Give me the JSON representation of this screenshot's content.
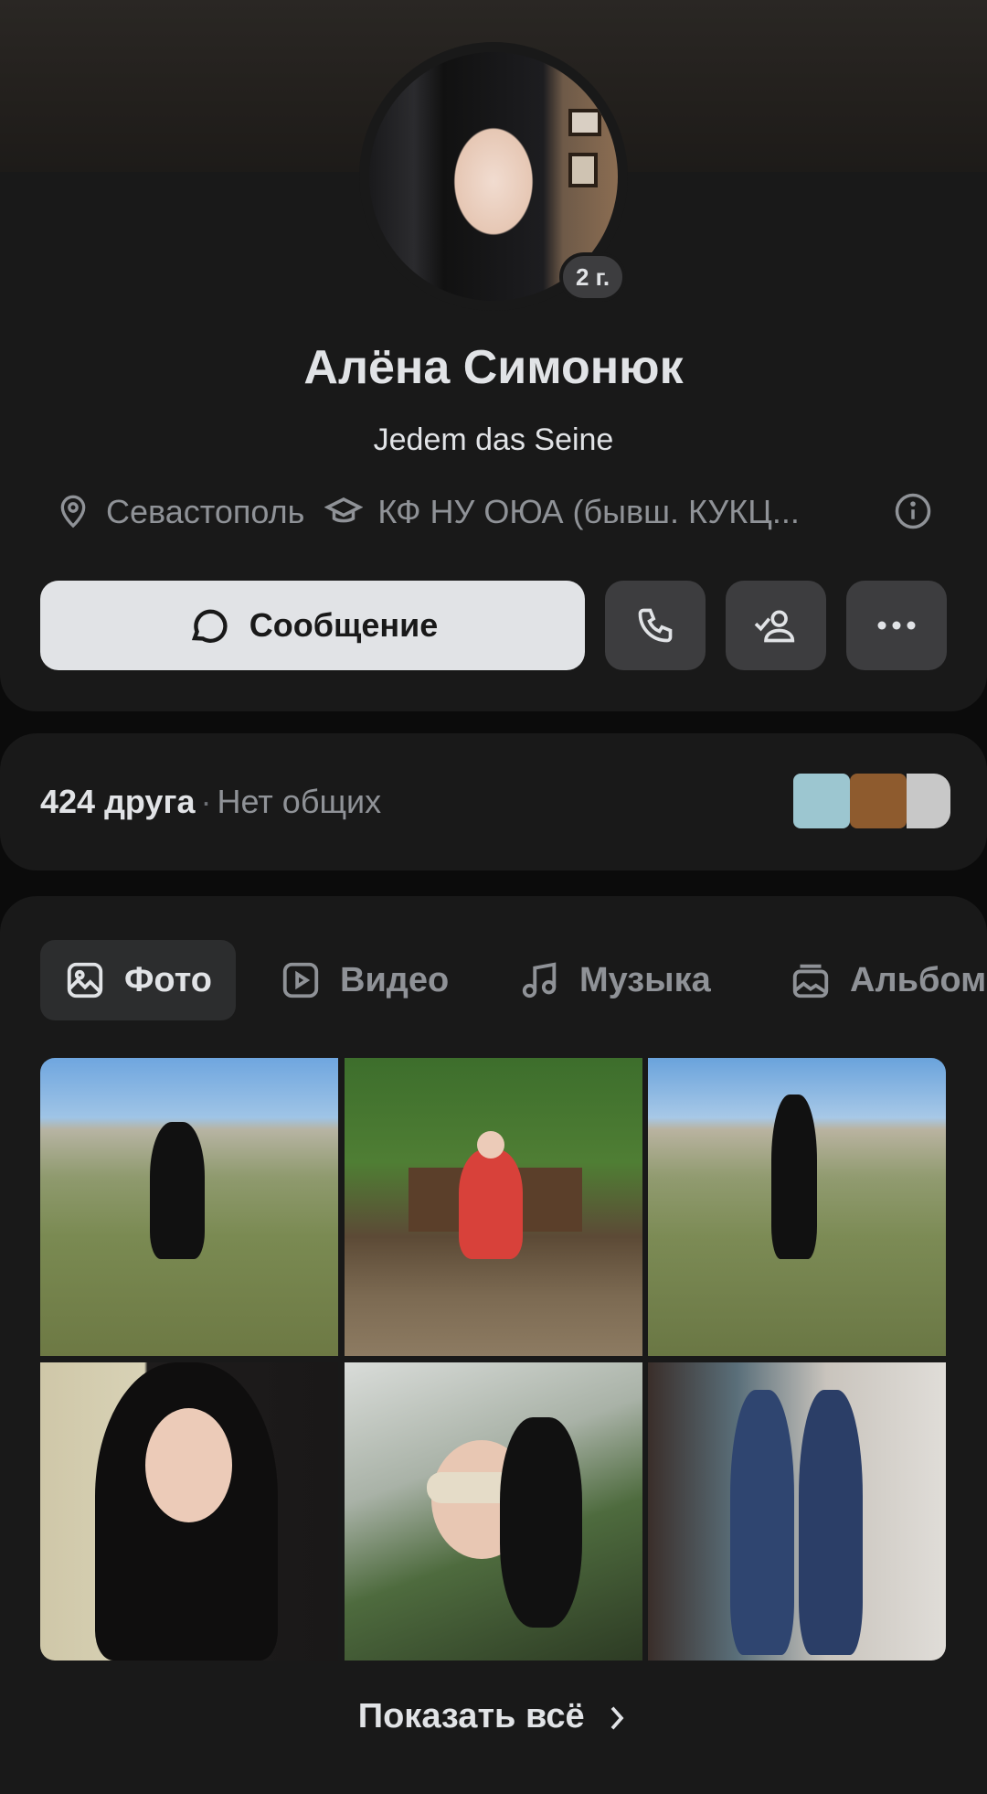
{
  "profile": {
    "name": "Алёна Симонюк",
    "status": "Jedem das Seine",
    "age_badge": "2 г.",
    "city": "Севастополь",
    "education": "КФ НУ ОЮА (бывш. КУКЦ...",
    "icons": {
      "city": "location-pin-icon",
      "education": "graduation-cap-icon",
      "more_info": "info-icon"
    }
  },
  "actions": {
    "message_label": "Сообщение",
    "call_icon": "phone-icon",
    "friend_icon": "user-check-icon",
    "more_icon": "more-dots-icon"
  },
  "friends": {
    "count_label": "424 друга",
    "separator": "·",
    "mutual_label": "Нет общих",
    "preview_colors": [
      "#9cc6d0",
      "#8e5b2e",
      "#c8c8c8"
    ]
  },
  "media": {
    "tabs": [
      {
        "label": "Фото",
        "icon": "photo-icon",
        "active": true
      },
      {
        "label": "Видео",
        "icon": "video-icon",
        "active": false
      },
      {
        "label": "Музыка",
        "icon": "music-note-icon",
        "active": false
      },
      {
        "label": "Альбомы",
        "icon": "album-icon",
        "active": false
      }
    ],
    "show_all_label": "Показать всё"
  },
  "colors": {
    "background": "#0b0b0b",
    "card": "#191919",
    "text_primary": "#e1e3e6",
    "text_secondary": "#8f9297",
    "button_dark": "#3d3d3f",
    "button_light": "#e1e3e6"
  }
}
